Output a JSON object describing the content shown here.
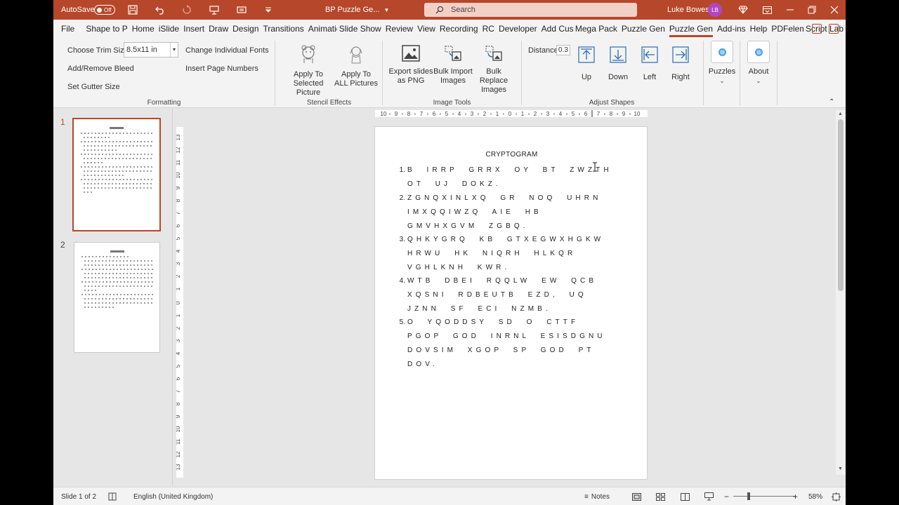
{
  "titlebar": {
    "autosave_label": "AutoSave",
    "autosave_state": "Off",
    "doc_title": "BP Puzzle Ge...",
    "search_placeholder": "Search",
    "user_name": "Luke Bowes",
    "user_initials": "LB"
  },
  "tabs": [
    "File",
    "Shape to P",
    "Home",
    "iSlide",
    "Insert",
    "Draw",
    "Design",
    "Transitions",
    "Animations",
    "Slide Show",
    "Review",
    "View",
    "Recording",
    "RC",
    "Developer",
    "Add Custom",
    "Mega Pack",
    "Puzzle Gen",
    "Puzzle Gen",
    "Add-ins",
    "Help",
    "PDFelement",
    "Script Lab"
  ],
  "active_tab_index": 18,
  "ribbon": {
    "formatting": {
      "choose_trim_label": "Choose Trim Size",
      "trim_value": "8.5x11 in",
      "change_fonts": "Change Individual Fonts",
      "add_bleed": "Add/Remove Bleed",
      "insert_page_numbers": "Insert Page Numbers",
      "set_gutter": "Set Gutter Size",
      "group_label": "Formatting"
    },
    "stencil": {
      "apply_selected": [
        "Apply To",
        "Selected Picture"
      ],
      "apply_all": [
        "Apply To",
        "ALL Pictures"
      ],
      "group_label": "Stencil Effects"
    },
    "image_tools": {
      "export": [
        "Export slides",
        "as PNG"
      ],
      "bulk_import": [
        "Bulk Import",
        "Images"
      ],
      "bulk_replace": [
        "Bulk Replace",
        "Images"
      ],
      "group_label": "Image Tools"
    },
    "adjust_shapes": {
      "distance_label": "Distance",
      "distance_value": "0.3",
      "up": "Up",
      "down": "Down",
      "left": "Left",
      "right": "Right",
      "group_label": "Adjust Shapes"
    },
    "puzzles": "Puzzles",
    "about": "About"
  },
  "thumbnails": [
    "1",
    "2"
  ],
  "slide": {
    "title": "CRYPTOGRAM",
    "items": [
      {
        "num": "1.",
        "lines": [
          "B  IRRP  GRRX  OY  BT  ZWZTH",
          "OT  UJ  DOKZ."
        ]
      },
      {
        "num": "2.",
        "lines": [
          "ZGNQXINLXQ  GR  NOQ  UHRN",
          "IMXQQIWZQ  AIE  HB",
          "GMVHXGVM  ZGBQ."
        ]
      },
      {
        "num": "3.",
        "lines": [
          "QHKYGRQ  KB  GTXEGWXHGKW",
          "HRWU  HK  NIQRH  HLKQR",
          "VGHLKNH  KWR."
        ]
      },
      {
        "num": "4.",
        "lines": [
          "WTB  DBEI  RQQLW  EW  QCB",
          "XQSNI  RDBEUTB  EZD,  UQ",
          "JZNN  SF  ECI  NZMB."
        ]
      },
      {
        "num": "5.",
        "lines": [
          "O  YQODDSY  SD  O  CTTF",
          "PGOP  GOD  INRNL  ESISDGNU",
          "DOVSIM  XGOP  SP  GOD  PT",
          "DOV."
        ]
      }
    ]
  },
  "status": {
    "slide_info": "Slide 1 of 2",
    "language": "English (United Kingdom)",
    "notes": "Notes",
    "zoom": "58%"
  },
  "colors": {
    "accent": "#b7472a",
    "ribbon_bg": "#f3f3f3",
    "workspace": "#e6e6e6"
  }
}
